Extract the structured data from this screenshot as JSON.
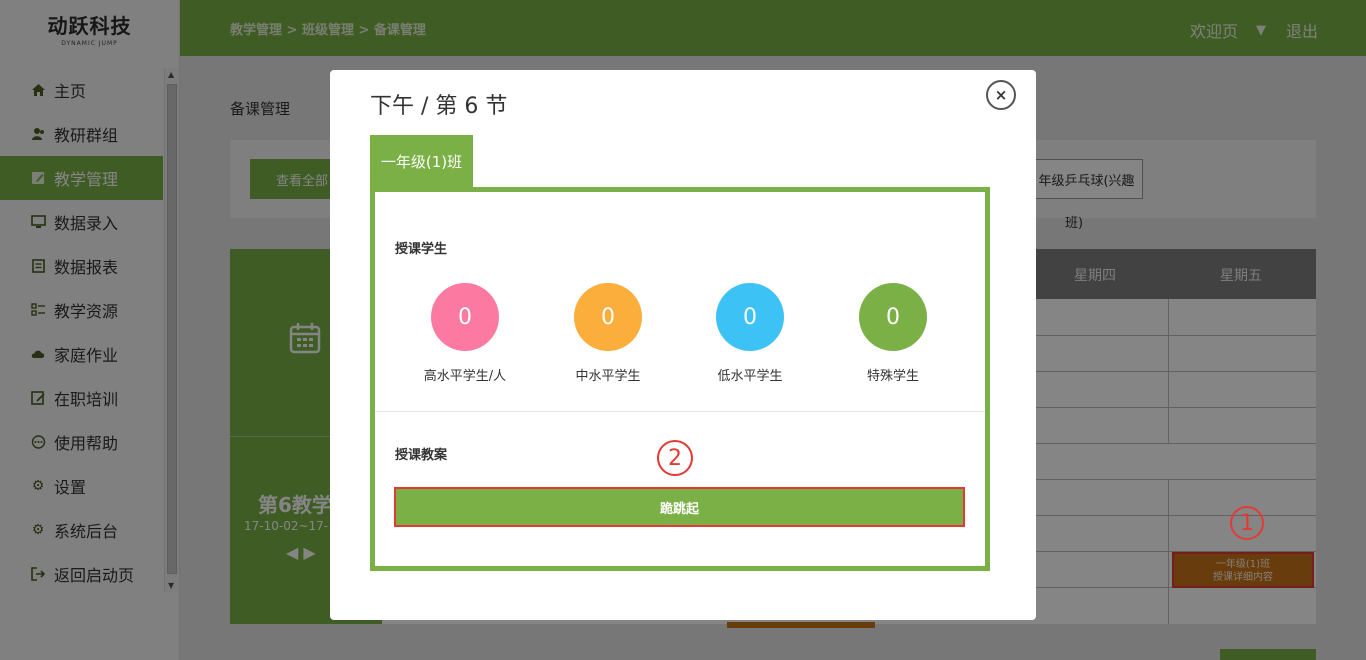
{
  "logo": {
    "main": "动跃科技",
    "sub": "DYNAMIC JUMP"
  },
  "sidebar": {
    "items": [
      {
        "label": "主页",
        "icon": "home-icon",
        "active": false
      },
      {
        "label": "教研群组",
        "icon": "users-icon",
        "active": false
      },
      {
        "label": "教学管理",
        "icon": "edit-icon",
        "active": true
      },
      {
        "label": "数据录入",
        "icon": "monitor-icon",
        "active": false
      },
      {
        "label": "数据报表",
        "icon": "report-icon",
        "active": false
      },
      {
        "label": "教学资源",
        "icon": "resource-icon",
        "active": false
      },
      {
        "label": "家庭作业",
        "icon": "cloud-icon",
        "active": false
      },
      {
        "label": "在职培训",
        "icon": "training-icon",
        "active": false
      },
      {
        "label": "使用帮助",
        "icon": "help-icon",
        "active": false
      },
      {
        "label": "设置",
        "icon": "gear-icon",
        "active": false
      },
      {
        "label": "系统后台",
        "icon": "admin-gear-icon",
        "active": false
      },
      {
        "label": "返回启动页",
        "icon": "exit-icon",
        "active": false
      }
    ]
  },
  "header": {
    "breadcrumb": "教学管理 > 班级管理 > 备课管理",
    "welcome": "欢迎页",
    "logout": "退出"
  },
  "page": {
    "title": "备课管理",
    "view_all_button": "查看全部",
    "filter_chip": "年级乒乓球(兴趣",
    "filter_chip_cont": "班)"
  },
  "week": {
    "title": "第6教学",
    "range": "17-10-02~17-",
    "arrows": "◀ ▶"
  },
  "schedule": {
    "days": [
      "星期四",
      "星期五"
    ],
    "lesson_cell": {
      "line1": "一年级(1)班",
      "line2": "授课详细内容"
    }
  },
  "markers": {
    "one": "1",
    "two": "2"
  },
  "modal": {
    "title": "下午 / 第 6 节",
    "close_symbol": "×",
    "tab": "一年级(1)班",
    "students_section": "授课学生",
    "stats": [
      {
        "value": "0",
        "label": "高水平学生/人",
        "color": "#fc7aa2"
      },
      {
        "value": "0",
        "label": "中水平学生",
        "color": "#fcae3c"
      },
      {
        "value": "0",
        "label": "低水平学生",
        "color": "#3dc2f5"
      },
      {
        "value": "0",
        "label": "特殊学生",
        "color": "#7ab046"
      }
    ],
    "plan_section": "授课教案",
    "plan_button": "跪跳起"
  },
  "colors": {
    "accent_green": "#7ab046",
    "lesson_orange": "#c7741a",
    "highlight_red": "#e53935"
  }
}
